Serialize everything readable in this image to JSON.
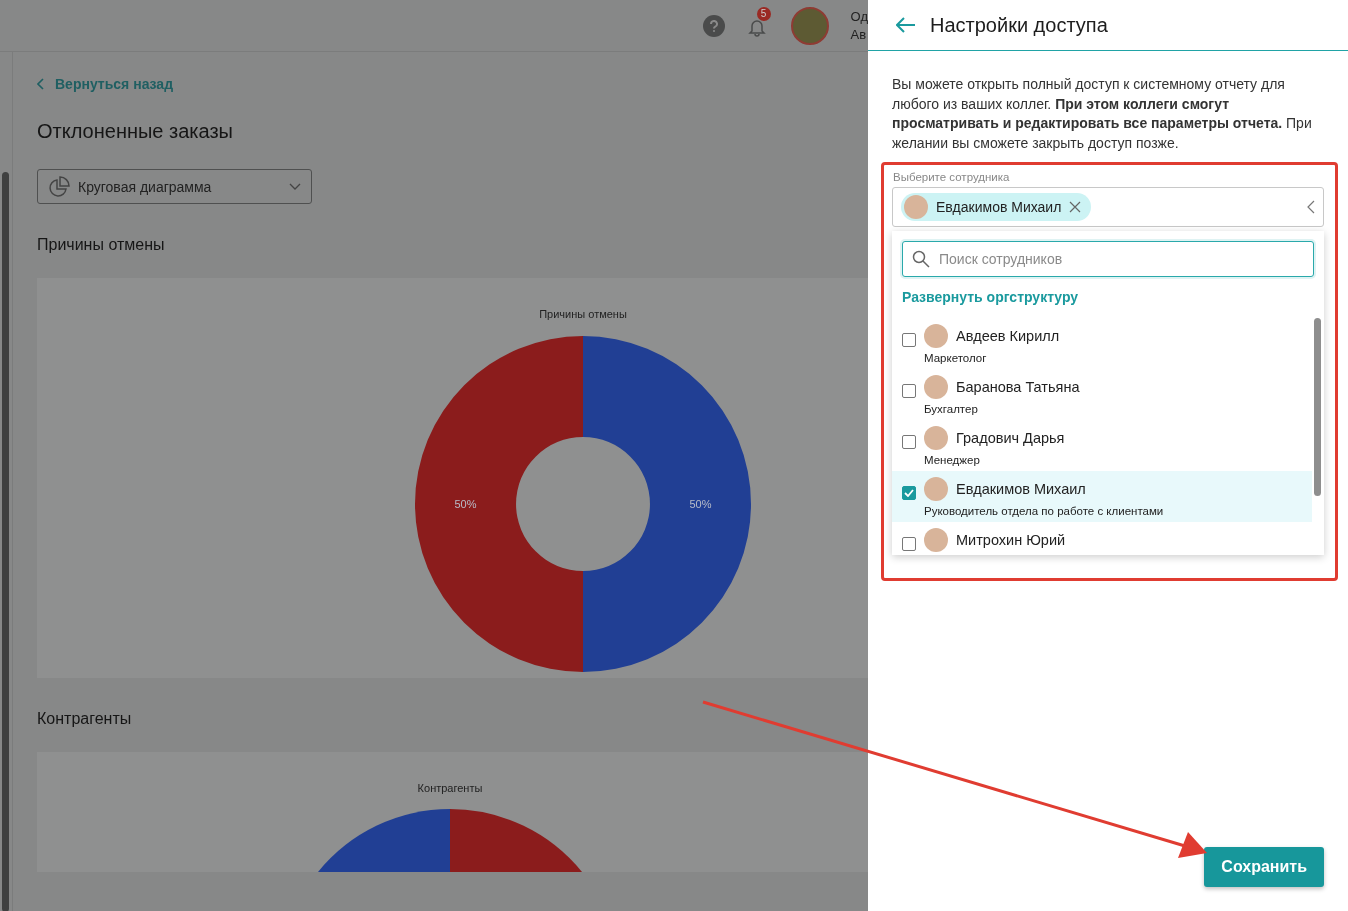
{
  "header": {
    "notification_count": "5",
    "user_name_line_1": "Од",
    "user_name_line_2": "Ав"
  },
  "back_link": "Вернуться назад",
  "page_title": "Отклоненные заказы",
  "chart_type_select": {
    "value": "Круговая диаграмма"
  },
  "sections": [
    {
      "heading": "Причины отмены",
      "chart_data": {
        "type": "donut",
        "title": "Причины отмены",
        "values": [
          50,
          50
        ],
        "colors": [
          "#213f94",
          "#8b1c1c"
        ],
        "value_labels": [
          "50%",
          "50%"
        ]
      }
    },
    {
      "heading": "Контрагенты",
      "chart_title": "Контрагенты"
    }
  ],
  "panel": {
    "title": "Настройки доступа",
    "description": "Вы можете открыть полный доступ к системному отчету для любого из ваших коллег. **При этом коллеги смогут просматривать и редактировать все параметры отчета.** При желании вы сможете закрыть доступ позже.",
    "employee_select": {
      "label": "Выберите сотрудника",
      "chips": [
        "Евдакимов Михаил"
      ],
      "expanded": true
    },
    "search": {
      "placeholder": "Поиск сотрудников"
    },
    "expand_link": "Развернуть оргструктуру",
    "employees": [
      {
        "name": "Авдеев Кирилл",
        "role": "Маркетолог",
        "checked": false,
        "selected": false
      },
      {
        "name": "Баранова Татьяна",
        "role": "Бухгалтер",
        "checked": false,
        "selected": false
      },
      {
        "name": "Градович Дарья",
        "role": "Менеджер",
        "checked": false,
        "selected": false
      },
      {
        "name": "Евдакимов Михаил",
        "role": "Руководитель отдела по работе с клиентами",
        "checked": true,
        "selected": true
      },
      {
        "name": "Митрохин Юрий",
        "checked": false,
        "selected": false
      }
    ],
    "save_button": "Сохранить"
  }
}
